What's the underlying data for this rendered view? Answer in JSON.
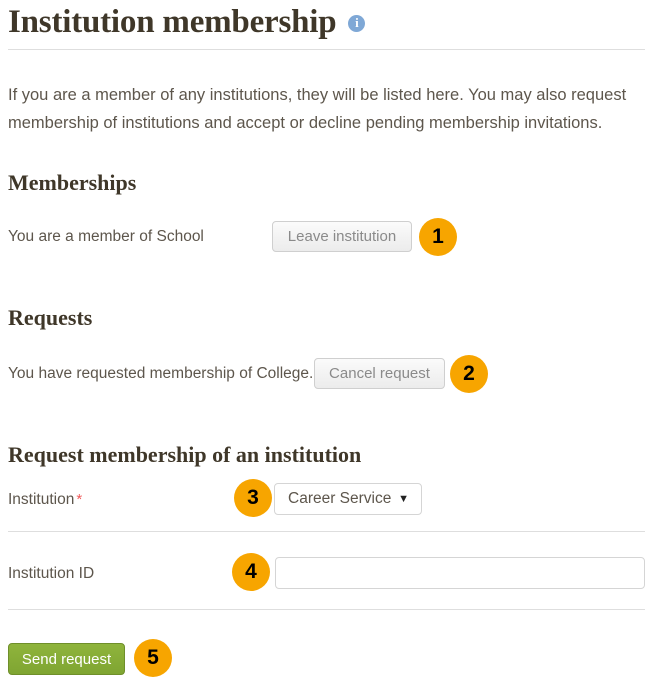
{
  "page": {
    "title": "Institution membership",
    "info_icon": "info-circle-icon",
    "intro": "If you are a member of any institutions, they will be listed here. You may also request membership of institutions and accept or decline pending membership invitations."
  },
  "memberships": {
    "heading": "Memberships",
    "row_label": "You are a member of School",
    "leave_button": "Leave institution",
    "badge": "1"
  },
  "requests": {
    "heading": "Requests",
    "row_label": "You have requested membership of College.",
    "cancel_button": "Cancel request",
    "badge": "2"
  },
  "request_form": {
    "heading": "Request membership of an institution",
    "institution": {
      "label": "Institution",
      "required_marker": "*",
      "selected": "Career Service",
      "arrow": "▼",
      "badge": "3"
    },
    "institution_id": {
      "label": "Institution ID",
      "value": "",
      "placeholder": "",
      "badge": "4"
    },
    "submit_button": "Send request",
    "submit_badge": "5"
  },
  "colors": {
    "accent_orange": "#f7a500",
    "submit_green": "#84a938",
    "heading_brown": "#3f3729",
    "body_text": "#5d564c",
    "required_red": "#ef5a5a",
    "info_blue": "#7fa8d6",
    "divider": "#dedede"
  }
}
